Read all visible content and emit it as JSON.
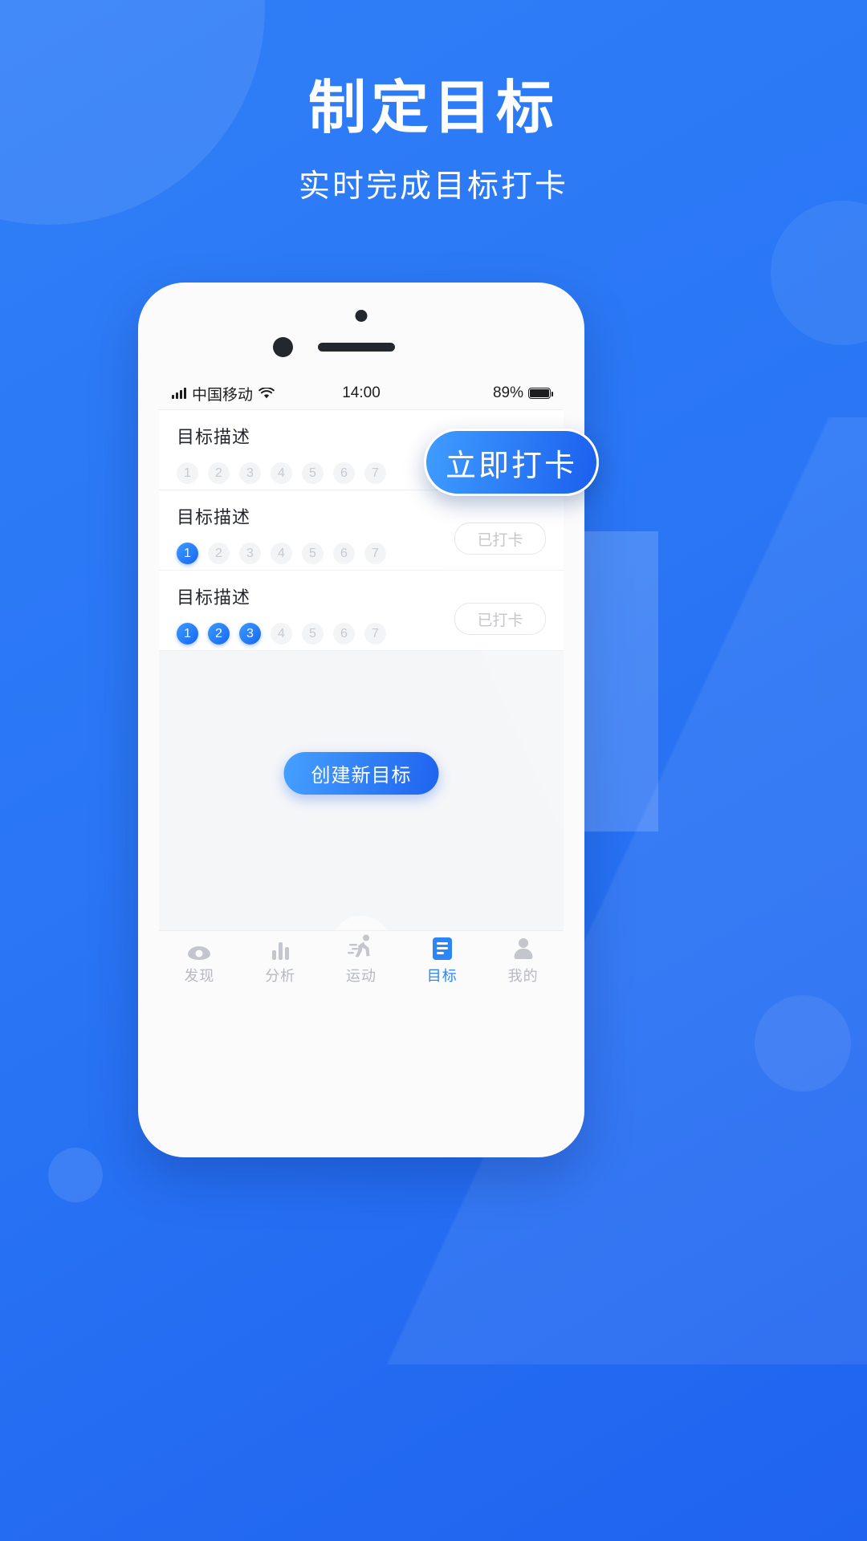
{
  "header": {
    "title": "制定目标",
    "subtitle": "实时完成目标打卡"
  },
  "colors": {
    "background": "#2b7bf6",
    "accent": "#2b86f7",
    "gradient_start": "#46a0ff",
    "gradient_end": "#1e63ef",
    "inactive": "#c3c6cc",
    "card_bg": "#ffffff",
    "empty_bg": "#f5f6f8"
  },
  "status_bar": {
    "signal_icon": "signal-bars-icon",
    "carrier": "中国移动",
    "wifi_icon": "wifi-icon",
    "time": "14:00",
    "battery_percent": "89%",
    "battery_icon": "battery-full-icon"
  },
  "callout": {
    "label": "立即打卡"
  },
  "goals": [
    {
      "title": "目标描述",
      "days": [
        "1",
        "2",
        "3",
        "4",
        "5",
        "6",
        "7"
      ],
      "completed": 0,
      "button_label": "已打卡",
      "show_button": false
    },
    {
      "title": "目标描述",
      "days": [
        "1",
        "2",
        "3",
        "4",
        "5",
        "6",
        "7"
      ],
      "completed": 1,
      "button_label": "已打卡",
      "show_button": true
    },
    {
      "title": "目标描述",
      "days": [
        "1",
        "2",
        "3",
        "4",
        "5",
        "6",
        "7"
      ],
      "completed": 3,
      "button_label": "已打卡",
      "show_button": true
    }
  ],
  "create_button": {
    "label": "创建新目标"
  },
  "tabbar": {
    "active_index": 3,
    "items": [
      {
        "label": "发现",
        "icon": "eye-icon"
      },
      {
        "label": "分析",
        "icon": "bar-chart-icon"
      },
      {
        "label": "运动",
        "icon": "runner-icon"
      },
      {
        "label": "目标",
        "icon": "document-icon"
      },
      {
        "label": "我的",
        "icon": "person-icon"
      }
    ]
  }
}
